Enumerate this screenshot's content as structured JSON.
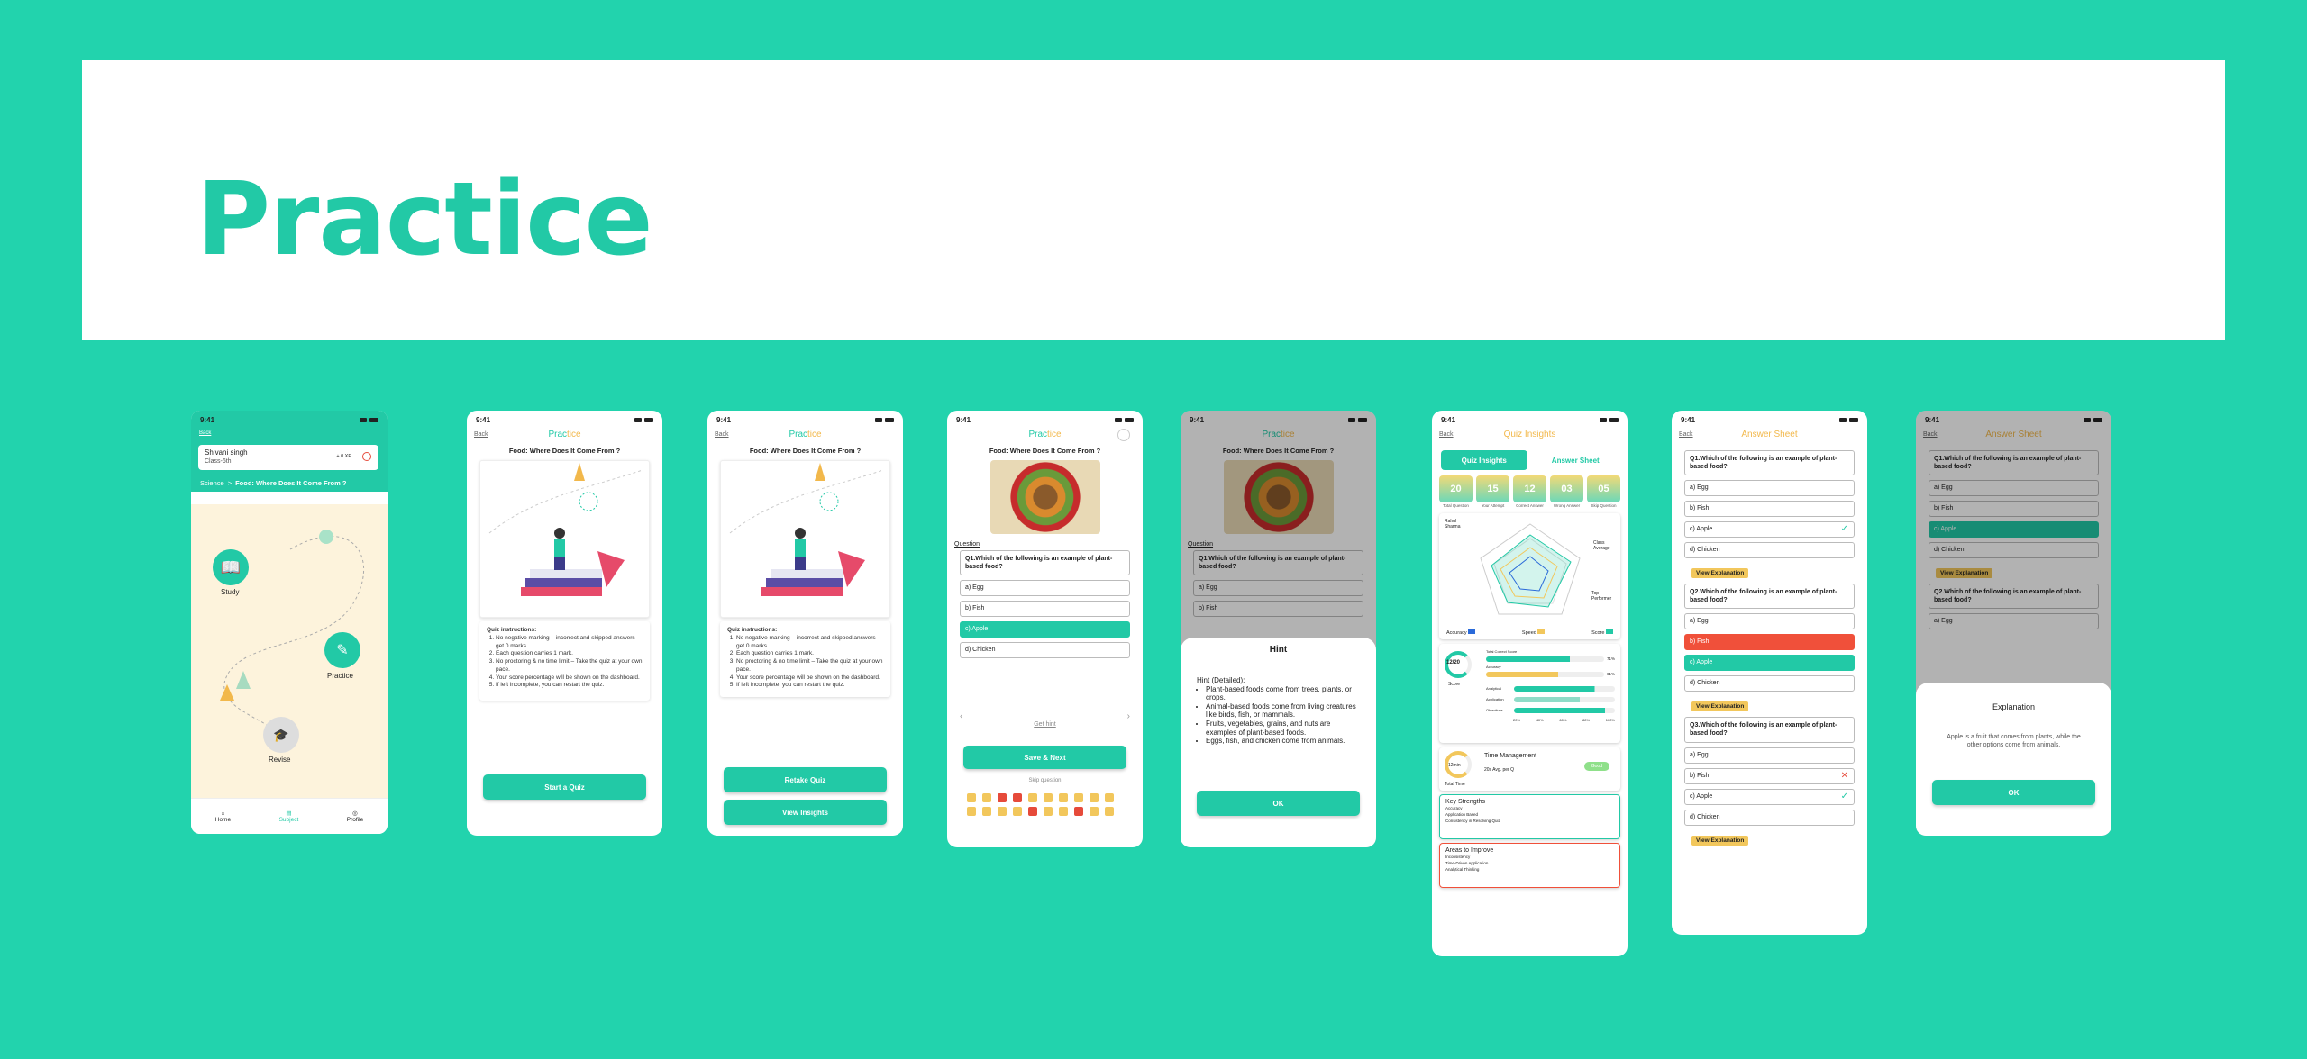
{
  "page_title": "Practice",
  "colors": {
    "background": "#22d3ad",
    "accent": "#22c9a6",
    "yellow": "#f2c75c",
    "red": "#e64a3a"
  },
  "status_time": "9:41",
  "back": "Back",
  "title_word": {
    "part1": "Prac",
    "part2": "tice"
  },
  "topic": "Food: Where Does It Come From ?",
  "topic_alt": "Food: Where Does It Come From ?",
  "home": {
    "user_name": "Shivani singh",
    "user_class": "Class-6th",
    "xp": "+ 0 XP",
    "breadcrumb_subject": "Science",
    "breadcrumb_sep": ">",
    "breadcrumb_topic": "Food: Where Does It Come From ?",
    "nodes": {
      "study": "Study",
      "practice": "Practice",
      "revise": "Revise"
    },
    "nav": {
      "home": "Home",
      "subject": "Subject",
      "profile": "Profile"
    }
  },
  "instructions": {
    "heading": "Quiz instructions:",
    "items": [
      "No negative marking – incorrect and skipped answers get 0 marks.",
      "Each question carries 1 mark.",
      "No proctoring & no time limit – Take the quiz at your own pace.",
      "Your score percentage will be shown on the dashboard.",
      "If left incomplete, you can restart the quiz."
    ]
  },
  "buttons": {
    "start_quiz": "Start a Quiz",
    "retake_quiz": "Retake Quiz",
    "view_insights": "View Insights",
    "save_next": "Save & Next",
    "ok": "OK",
    "view_explanation": "View Explanation"
  },
  "question_label": "Question",
  "q1": "Q1.Which of the following is an example of plant-based food?",
  "q2": "Q2.Which of the following is an example of plant-based food?",
  "q3": "Q3.Which of the following is an example of plant-based food?",
  "options": {
    "a": "a) Egg",
    "b": "b) Fish",
    "c": "c) Apple",
    "d": "d) Chicken"
  },
  "get_hint": "Get hint",
  "skip_question": "Skip question",
  "nav_prev": "‹",
  "nav_next": "›",
  "hint": {
    "title": "Hint",
    "subtitle": "Hint (Detailed):",
    "items": [
      "Plant-based foods come from trees, plants, or crops.",
      "Animal-based foods come from living creatures like birds, fish, or mammals.",
      "Fruits, vegetables, grains, and nuts are examples of plant-based foods.",
      "Eggs, fish, and chicken come from animals."
    ]
  },
  "insights": {
    "title": "Quiz Insights",
    "tab_insights": "Quiz Insights",
    "tab_answers": "Answer Sheet",
    "stats": [
      {
        "value": "20",
        "label": "Total Question"
      },
      {
        "value": "15",
        "label": "Your Attempt"
      },
      {
        "value": "12",
        "label": "Correct Answer"
      },
      {
        "value": "03",
        "label": "Wrong Answer"
      },
      {
        "value": "05",
        "label": "Skip Question"
      }
    ],
    "radar_labels": {
      "top_left": "Rahul Sharma",
      "right": "Class Average",
      "bottom_right": "Top Performer"
    },
    "legend": {
      "accuracy": "Accuracy",
      "speed": "Speed",
      "score": "Score"
    },
    "score": "12/20",
    "score_label": "Score",
    "bars": [
      {
        "label": "Total Correct Score",
        "value": "71%"
      },
      {
        "label": "Accuracy",
        "value": "61%"
      },
      {
        "label": "Analytical",
        "value": ""
      },
      {
        "label": "Application",
        "value": ""
      },
      {
        "label": "Objectives",
        "value": ""
      }
    ],
    "axis": [
      "20%",
      "40%",
      "60%",
      "80%",
      "100%"
    ],
    "time_value": "12min",
    "time_label": "Total Time",
    "time_mgmt": "Time Management",
    "time_avg": "20s Avg. per Q",
    "time_badge": "Good",
    "strengths_title": "Key Strengths",
    "strengths": [
      "Accuracy",
      "Application Based",
      "Consistency in Resolving Quiz"
    ],
    "improve_title": "Areas to Improve",
    "improve": [
      "Inconsistency",
      "Time-Driven Application",
      "Analytical Thinking"
    ]
  },
  "answer_sheet_title": "Answer Sheet",
  "explanation": {
    "title": "Explanation",
    "text": "Apple is a fruit that comes from plants, while the other options come from animals."
  }
}
